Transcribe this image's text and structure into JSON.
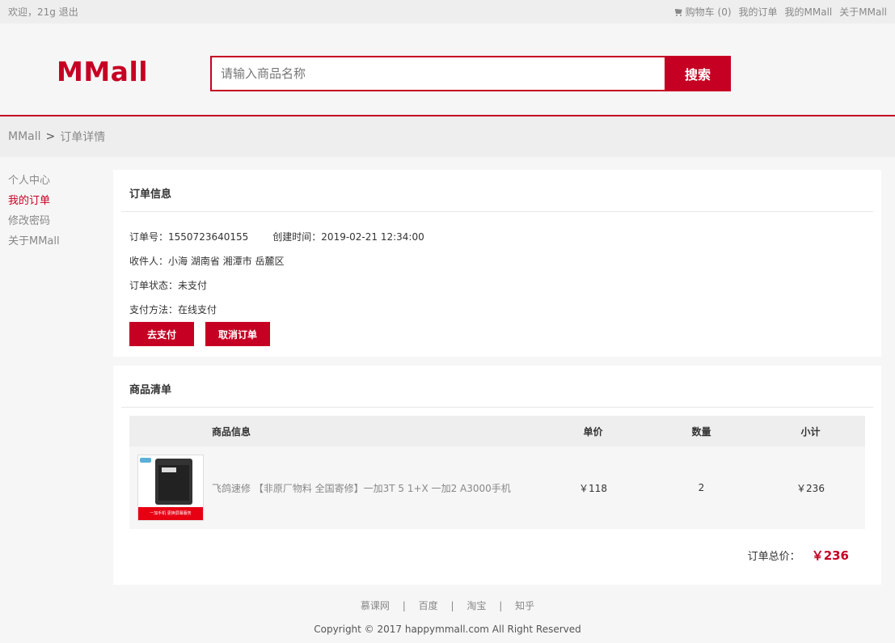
{
  "topnav": {
    "welcome": "欢迎，21g",
    "logout": "退出",
    "cart_label": "购物车",
    "cart_count": "(0)",
    "my_orders": "我的订单",
    "my_mmall": "我的MMall",
    "about": "关于MMall"
  },
  "header": {
    "logo": "MMall",
    "search_placeholder": "请输入商品名称",
    "search_button": "搜索"
  },
  "breadcrumb": {
    "home": "MMall",
    "separator": ">",
    "current": "订单详情"
  },
  "sidebar": {
    "items": [
      {
        "label": "个人中心"
      },
      {
        "label": "我的订单"
      },
      {
        "label": "修改密码"
      },
      {
        "label": "关于MMall"
      }
    ]
  },
  "order_info": {
    "title": "订单信息",
    "order_no_label": "订单号：",
    "order_no": "1550723640155",
    "created_label": "创建时间：",
    "created_time": "2019-02-21 12:34:00",
    "receiver_label": "收件人：",
    "receiver": "小海 湖南省 湘潭市 岳麓区",
    "status_label": "订单状态：",
    "status": "未支付",
    "payment_label": "支付方法：",
    "payment": "在线支付",
    "pay_button": "去支付",
    "cancel_button": "取消订单"
  },
  "product_list": {
    "title": "商品清单",
    "columns": [
      "商品信息",
      "单价",
      "数量",
      "小计"
    ],
    "rows": [
      {
        "name": "飞鸽速修 【非原厂物料 全国寄修】一加3T 5 1+X 一加2 A3000手机",
        "image_banner": "一加手机 更换屏幕服务",
        "price": "￥118",
        "quantity": "2",
        "subtotal": "￥236"
      }
    ],
    "total_label": "订单总价：",
    "total": "￥236"
  },
  "footer": {
    "links": [
      "慕课网",
      "百度",
      "淘宝",
      "知乎"
    ],
    "separator": "|",
    "copyright": "Copyright © 2017 happymmall.com All Right Reserved"
  },
  "colors": {
    "brand": "#c60023",
    "muted": "#888888"
  }
}
